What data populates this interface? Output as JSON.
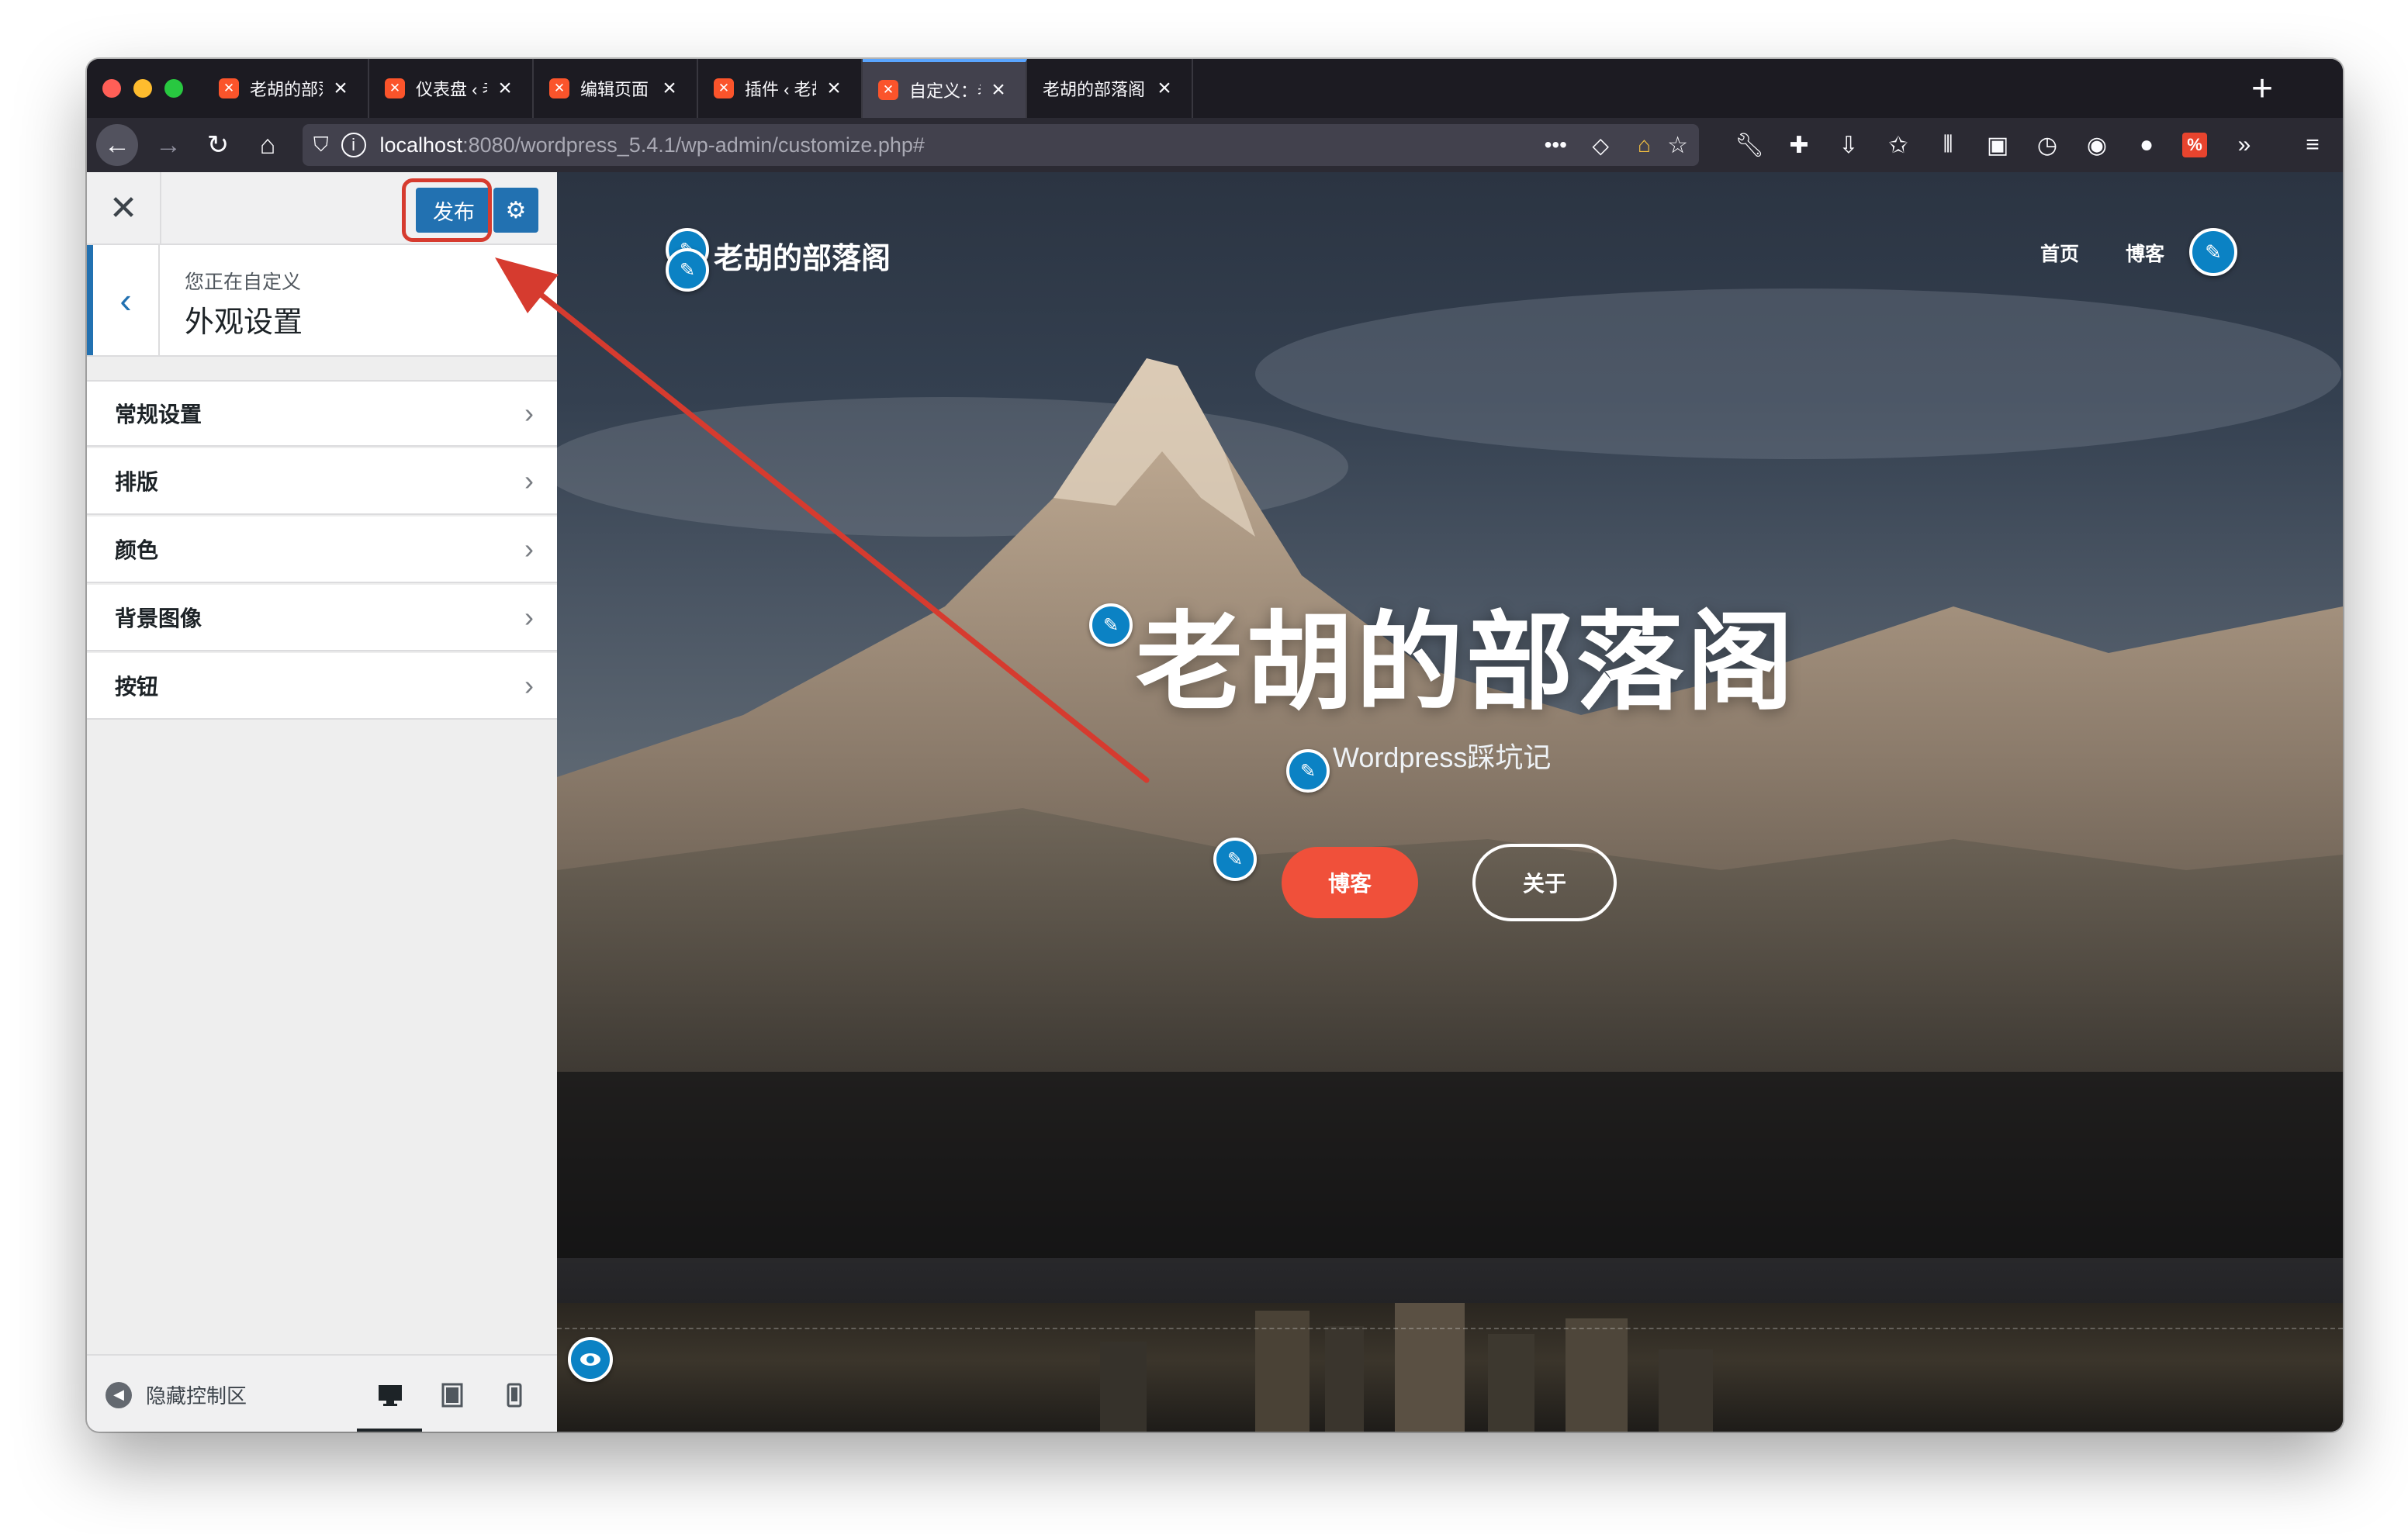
{
  "browser": {
    "tabs": [
      {
        "title": "老胡的部落阁 – Just another W",
        "favicon": "XAMPP",
        "active": false
      },
      {
        "title": "仪表盘 ‹ 老胡的部落阁 — Wor",
        "favicon": "XAMPP",
        "active": false
      },
      {
        "title": "编辑页面 ‹ 老胡的部落阁 — W",
        "favicon": "XAMPP",
        "active": false
      },
      {
        "title": "插件 ‹ 老胡的部落阁 — WordP",
        "favicon": "XAMPP",
        "active": false
      },
      {
        "title": "自定义：老胡的部落阁 – Just a",
        "favicon": "XAMPP",
        "active": true
      },
      {
        "title": "老胡的部落阁",
        "favicon": "",
        "active": false
      }
    ],
    "url_host": "localhost",
    "url_rest": ":8080/wordpress_5.4.1/wp-admin/customize.php#",
    "accent_color": "#5aa5ff"
  },
  "customizer": {
    "publish_label": "发布",
    "customizing_label": "您正在自定义",
    "section_title": "外观设置",
    "menu": [
      {
        "label": "常规设置"
      },
      {
        "label": "排版"
      },
      {
        "label": "颜色"
      },
      {
        "label": "背景图像"
      },
      {
        "label": "按钮"
      }
    ],
    "hide_controls_label": "隐藏控制区",
    "publish_color": "#2271b1"
  },
  "preview": {
    "site_title": "老胡的部落阁",
    "nav": [
      {
        "label": "首页"
      },
      {
        "label": "博客"
      }
    ],
    "hero_title": "老胡的部落阁",
    "hero_subtitle": "Wordpress踩坑记",
    "primary_button": "博客",
    "secondary_button": "关于",
    "primary_button_color": "#f0503a"
  },
  "annotation": {
    "color": "#d63b2f"
  }
}
